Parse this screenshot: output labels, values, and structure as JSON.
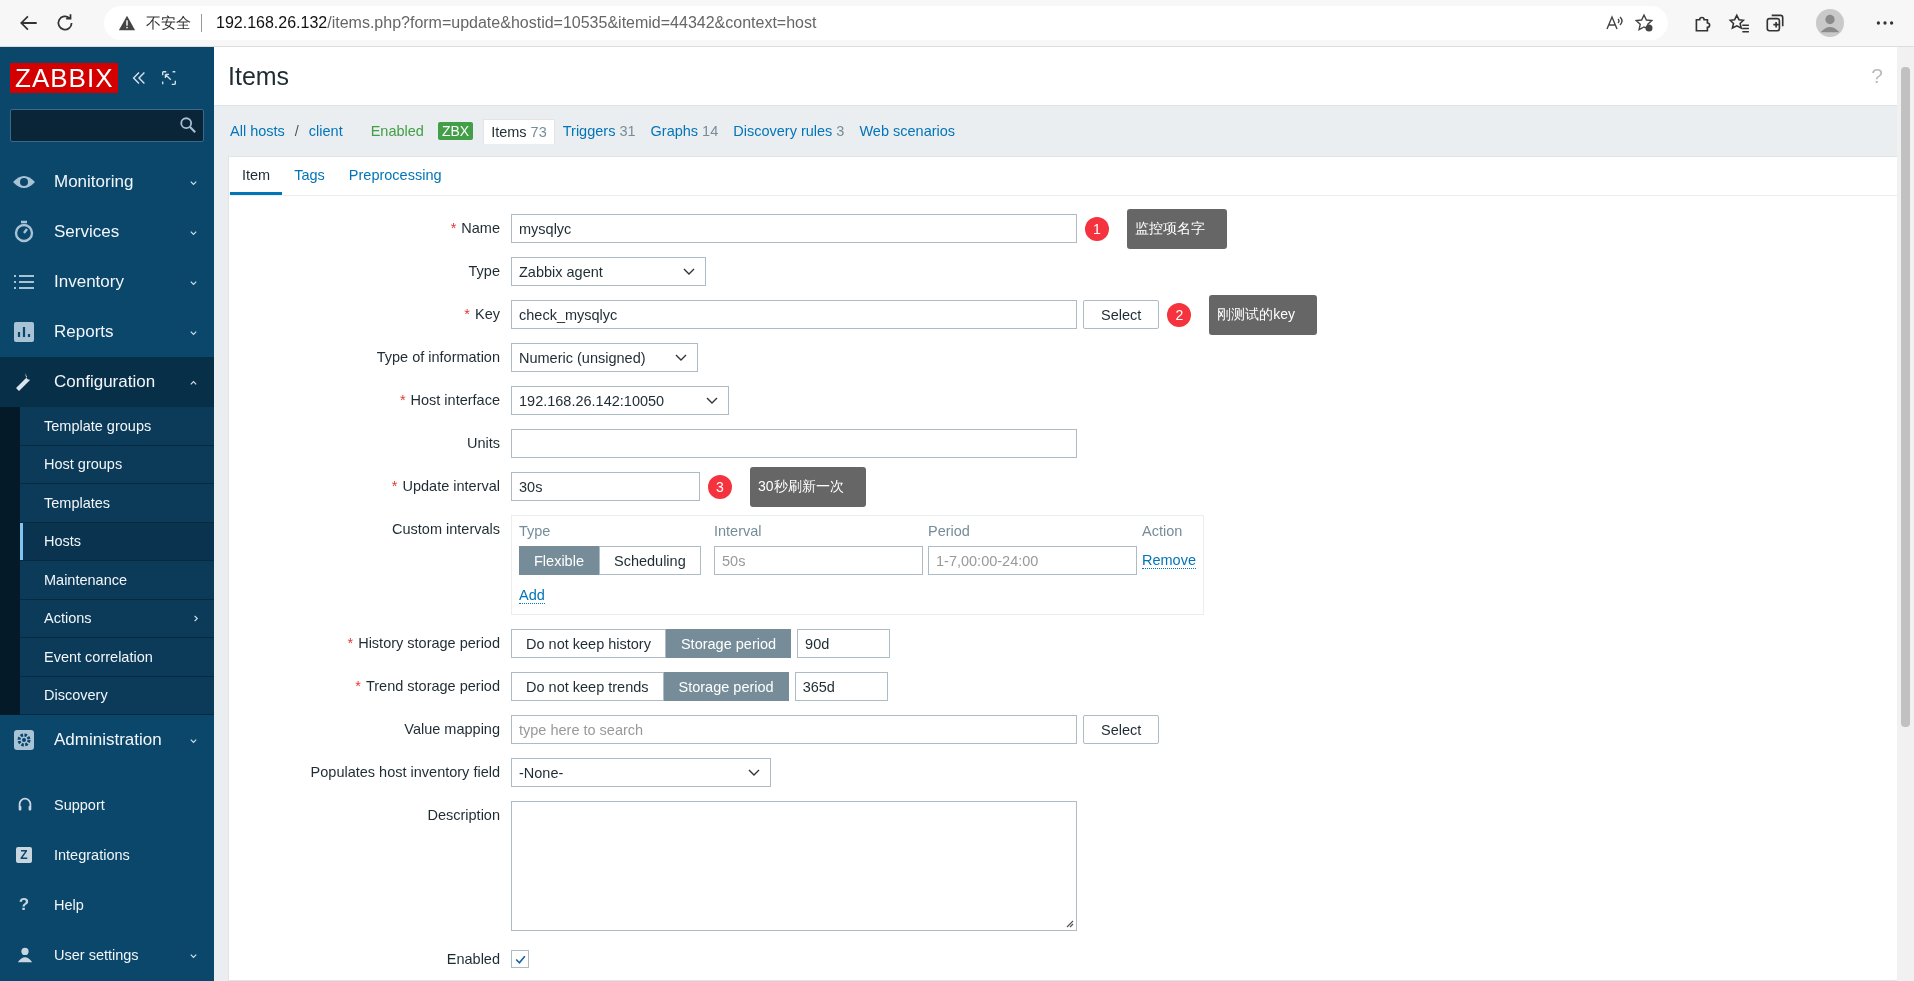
{
  "browser": {
    "security": "不安全",
    "host": "192.168.26.132",
    "path": "/items.php?form=update&hostid=10535&itemid=44342&context=host"
  },
  "sidebar": {
    "logo": "ZABBIX",
    "menu": [
      {
        "label": "Monitoring",
        "expanded": false
      },
      {
        "label": "Services",
        "expanded": false
      },
      {
        "label": "Inventory",
        "expanded": false
      },
      {
        "label": "Reports",
        "expanded": false
      },
      {
        "label": "Configuration",
        "expanded": true,
        "children": [
          {
            "label": "Template groups",
            "selected": false
          },
          {
            "label": "Host groups",
            "selected": false
          },
          {
            "label": "Templates",
            "selected": false
          },
          {
            "label": "Hosts",
            "selected": true
          },
          {
            "label": "Maintenance",
            "selected": false
          },
          {
            "label": "Actions",
            "selected": false,
            "submenu": true
          },
          {
            "label": "Event correlation",
            "selected": false
          },
          {
            "label": "Discovery",
            "selected": false
          }
        ]
      },
      {
        "label": "Administration",
        "expanded": false
      }
    ],
    "footer": [
      {
        "label": "Support"
      },
      {
        "label": "Integrations",
        "glyph": "Z"
      },
      {
        "label": "Help",
        "glyph": "?"
      },
      {
        "label": "User settings",
        "expanded": false
      }
    ]
  },
  "page": {
    "title": "Items",
    "help": "?"
  },
  "breadcrumb": {
    "path": [
      "All hosts",
      "client"
    ],
    "separator": "/",
    "status": "Enabled",
    "badge": "ZBX",
    "tabs": [
      {
        "label": "Items",
        "count": "73",
        "selected": true
      },
      {
        "label": "Triggers",
        "count": "31",
        "selected": false
      },
      {
        "label": "Graphs",
        "count": "14",
        "selected": false
      },
      {
        "label": "Discovery rules",
        "count": "3",
        "selected": false
      },
      {
        "label": "Web scenarios",
        "selected": false
      }
    ]
  },
  "form_tabs": [
    {
      "label": "Item",
      "selected": true
    },
    {
      "label": "Tags",
      "selected": false
    },
    {
      "label": "Preprocessing",
      "selected": false
    }
  ],
  "fields": [
    {
      "kind": "text",
      "label": "Name",
      "required": "*",
      "value": "mysqlyc",
      "note": {
        "number": "1",
        "text": "监控项名字"
      }
    },
    {
      "kind": "select",
      "label": "Type",
      "value": "Zabbix agent"
    },
    {
      "kind": "text_button",
      "label": "Key",
      "required": "*",
      "value": "check_mysqlyc",
      "button": "Select",
      "note": {
        "number": "2",
        "text": "刚测试的key"
      }
    },
    {
      "kind": "select",
      "label": "Type of information",
      "value": "Numeric (unsigned)"
    },
    {
      "kind": "select",
      "label": "Host interface",
      "required": "*",
      "value": "192.168.26.142:10050"
    },
    {
      "kind": "text",
      "label": "Units"
    },
    {
      "kind": "text",
      "label": "Update interval",
      "required": "*",
      "value": "30s",
      "note": {
        "number": "3",
        "text": "30秒刷新一次"
      }
    },
    {
      "kind": "intervals",
      "label": "Custom intervals",
      "columns": [
        "Type",
        "Interval",
        "Period",
        "Action"
      ],
      "rows": [
        {
          "options": [
            {
              "label": "Flexible",
              "selected": true
            },
            {
              "label": "Scheduling",
              "selected": false
            }
          ],
          "interval_placeholder": "50s",
          "period_placeholder": "1-7,00:00-24:00",
          "action": "Remove"
        }
      ],
      "add": "Add"
    },
    {
      "kind": "period",
      "label": "History storage period",
      "required": "*",
      "options": [
        {
          "label": "Do not keep history",
          "selected": false
        },
        {
          "label": "Storage period",
          "selected": true
        }
      ],
      "value": "90d"
    },
    {
      "kind": "period",
      "label": "Trend storage period",
      "required": "*",
      "options": [
        {
          "label": "Do not keep trends",
          "selected": false
        },
        {
          "label": "Storage period",
          "selected": true
        }
      ],
      "value": "365d"
    },
    {
      "kind": "text_button",
      "label": "Value mapping",
      "placeholder": "type here to search",
      "button": "Select"
    },
    {
      "kind": "select",
      "label": "Populates host inventory field",
      "value": "-None-"
    },
    {
      "kind": "textarea",
      "label": "Description"
    },
    {
      "kind": "checkbox",
      "label": "Enabled",
      "checked": true
    }
  ]
}
